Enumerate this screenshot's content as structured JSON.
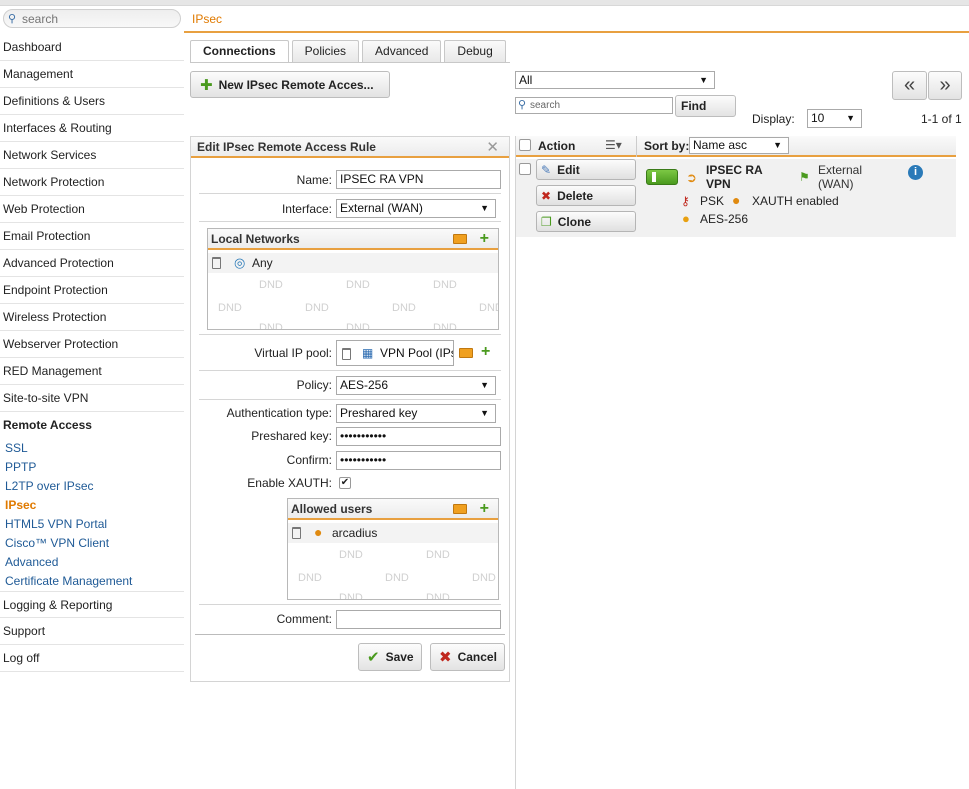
{
  "sidebar": {
    "search_placeholder": "search",
    "items": [
      {
        "label": "Dashboard"
      },
      {
        "label": "Management"
      },
      {
        "label": "Definitions & Users"
      },
      {
        "label": "Interfaces & Routing"
      },
      {
        "label": "Network Services"
      },
      {
        "label": "Network Protection"
      },
      {
        "label": "Web Protection"
      },
      {
        "label": "Email Protection"
      },
      {
        "label": "Advanced Protection"
      },
      {
        "label": "Endpoint Protection"
      },
      {
        "label": "Wireless Protection"
      },
      {
        "label": "Webserver Protection"
      },
      {
        "label": "RED Management"
      },
      {
        "label": "Site-to-site VPN"
      }
    ],
    "remote_access": {
      "label": "Remote Access",
      "subitems": [
        {
          "label": "SSL"
        },
        {
          "label": "PPTP"
        },
        {
          "label": "L2TP over IPsec"
        },
        {
          "label": "IPsec"
        },
        {
          "label": "HTML5 VPN Portal"
        },
        {
          "label": "Cisco™ VPN Client"
        },
        {
          "label": "Advanced"
        },
        {
          "label": "Certificate Management"
        }
      ]
    },
    "bottom_items": [
      {
        "label": "Logging & Reporting"
      },
      {
        "label": "Support"
      },
      {
        "label": "Log off"
      }
    ]
  },
  "page": {
    "title": "IPsec"
  },
  "tabs": [
    {
      "label": "Connections"
    },
    {
      "label": "Policies"
    },
    {
      "label": "Advanced"
    },
    {
      "label": "Debug"
    }
  ],
  "toolbar": {
    "new_button": "New IPsec Remote Acces...",
    "filter_value": "All",
    "search_placeholder": "search",
    "find_label": "Find",
    "display_label": "Display:",
    "display_value": "10",
    "page_info": "1-1 of 1",
    "prev_label": "«",
    "next_label": "»"
  },
  "edit_panel": {
    "title": "Edit IPsec Remote Access Rule",
    "name_label": "Name:",
    "name_value": "IPSEC RA VPN",
    "interface_label": "Interface:",
    "interface_value": "External (WAN)",
    "local_networks": {
      "title": "Local Networks",
      "entries": [
        "Any"
      ],
      "dnd": "DND"
    },
    "virtual_ip_label": "Virtual IP pool:",
    "virtual_ip_value": "VPN Pool (IPs",
    "policy_label": "Policy:",
    "policy_value": "AES-256",
    "auth_label": "Authentication type:",
    "auth_value": "Preshared key",
    "preshared_label": "Preshared key:",
    "preshared_value": "•••••••••••",
    "confirm_label": "Confirm:",
    "confirm_value": "•••••••••••",
    "xauth_label": "Enable XAUTH:",
    "xauth_checked": true,
    "allowed_users": {
      "title": "Allowed users",
      "entries": [
        "arcadius"
      ],
      "dnd": "DND"
    },
    "comment_label": "Comment:",
    "comment_value": "",
    "save_label": "Save",
    "cancel_label": "Cancel"
  },
  "list": {
    "action_header": "Action",
    "sort_label": "Sort by:",
    "sort_value": "Name asc",
    "rows": [
      {
        "name": "IPSEC RA VPN",
        "interface": "External (WAN)",
        "auth": "PSK",
        "xauth": "XAUTH enabled",
        "policy": "AES-256",
        "edit_label": "Edit",
        "delete_label": "Delete",
        "clone_label": "Clone"
      }
    ]
  },
  "colors": {
    "accent": "#e8a040",
    "active_nav": "#e07a00",
    "link": "#1f5a96",
    "green": "#4a9a1e",
    "red": "#c0281e"
  }
}
